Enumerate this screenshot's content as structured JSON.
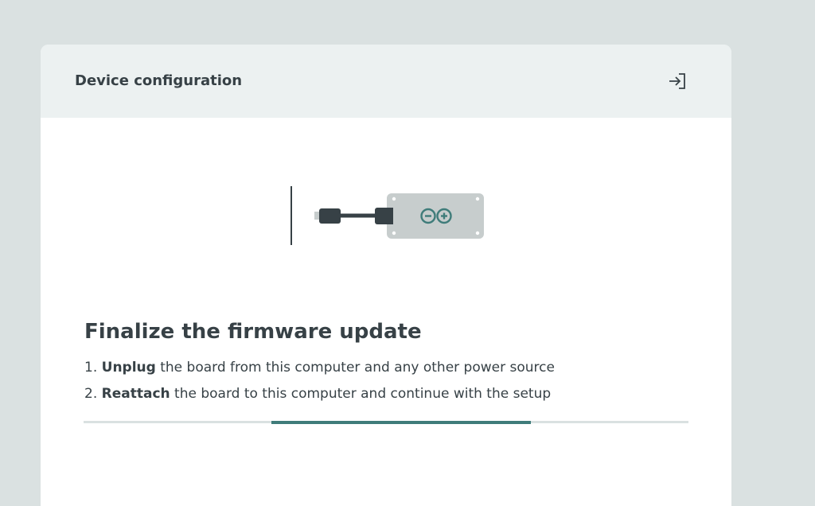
{
  "header": {
    "title": "Device configuration",
    "exit_icon": "exit-arrow-icon"
  },
  "illustration": {
    "icon": "board-usb-unplugged-icon",
    "brand_logo": "infinity-logo"
  },
  "main": {
    "title": "Finalize the firmware update",
    "steps": [
      {
        "number": "1.",
        "action": "Unplug",
        "rest": " the board from this computer and any other power source"
      },
      {
        "number": "2.",
        "action": "Reattach",
        "rest": " the board to this computer and continue with the setup"
      }
    ]
  },
  "progress": {
    "segment_start_fraction": 0.31,
    "segment_end_fraction": 0.74,
    "accent_color": "#3f7c7a"
  },
  "colors": {
    "background": "#dae1e1",
    "header_bg": "#ecf1f1",
    "text": "#374146",
    "board": "#c7cdcd",
    "logo": "#3f7c7a"
  }
}
